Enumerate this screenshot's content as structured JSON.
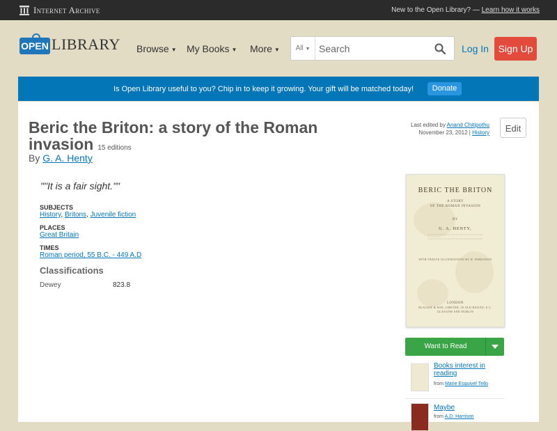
{
  "ia_bar": {
    "logo_text": "Internet Archive",
    "new_text": "New to the Open Library? —",
    "learn_link": "Learn how it works"
  },
  "header": {
    "logo_open": "OPEN",
    "logo_library": "LIBRARY",
    "nav": [
      {
        "label": "Browse"
      },
      {
        "label": "My Books"
      },
      {
        "label": "More"
      }
    ],
    "search_scope": "All",
    "search_placeholder": "Search",
    "login": "Log In",
    "signup": "Sign Up"
  },
  "donate": {
    "message": "Is Open Library useful to you? Chip in to keep it growing. Your gift will be matched today!",
    "button": "Donate"
  },
  "book": {
    "title": "Beric the Briton: a story of the Roman invasion",
    "editions": "15 editions",
    "by": "By",
    "author": "G. A. Henty",
    "last_edited_by_label": "Last edited by",
    "last_edited_by": "Anand Chitipothu",
    "last_edited_date": "November 23, 2012",
    "history_link": "History",
    "edit_button": "Edit",
    "quote": "\"\"It is a fair sight.\"\"",
    "subjects_label": "SUBJECTS",
    "subjects": [
      "History",
      "Britons",
      "Juvenile fiction"
    ],
    "places_label": "PLACES",
    "places": [
      "Great Britain"
    ],
    "times_label": "TIMES",
    "times": [
      "Roman period, 55 B.C. - 449 A.D"
    ],
    "classifications_label": "Classifications",
    "dewey_label": "Dewey",
    "dewey_value": "823.8"
  },
  "cover": {
    "title": "BERIC THE BRITON",
    "line1": "A STORY",
    "line2": "OF THE ROMAN INVASION",
    "by": "BY",
    "author": "G. A. HENTY,",
    "illus": "WITH TWELVE ILLUSTRATIONS BY W. PARKINSON",
    "city": "LONDON",
    "publisher": "BLACKIE & SON, LIMITED, 50 OLD BAILEY, E.C.",
    "publisher2": "GLASGOW AND DUBLIN"
  },
  "reading": {
    "want_to_read": "Want to Read"
  },
  "lists": [
    {
      "name": "Books interest in reading",
      "from_label": "from",
      "from": "Marie Esquivel Tello",
      "color": "#efe9d2"
    },
    {
      "name": "Maybe",
      "from_label": "from",
      "from": "A.D. Harrison",
      "color": "#8b2a1f"
    }
  ]
}
